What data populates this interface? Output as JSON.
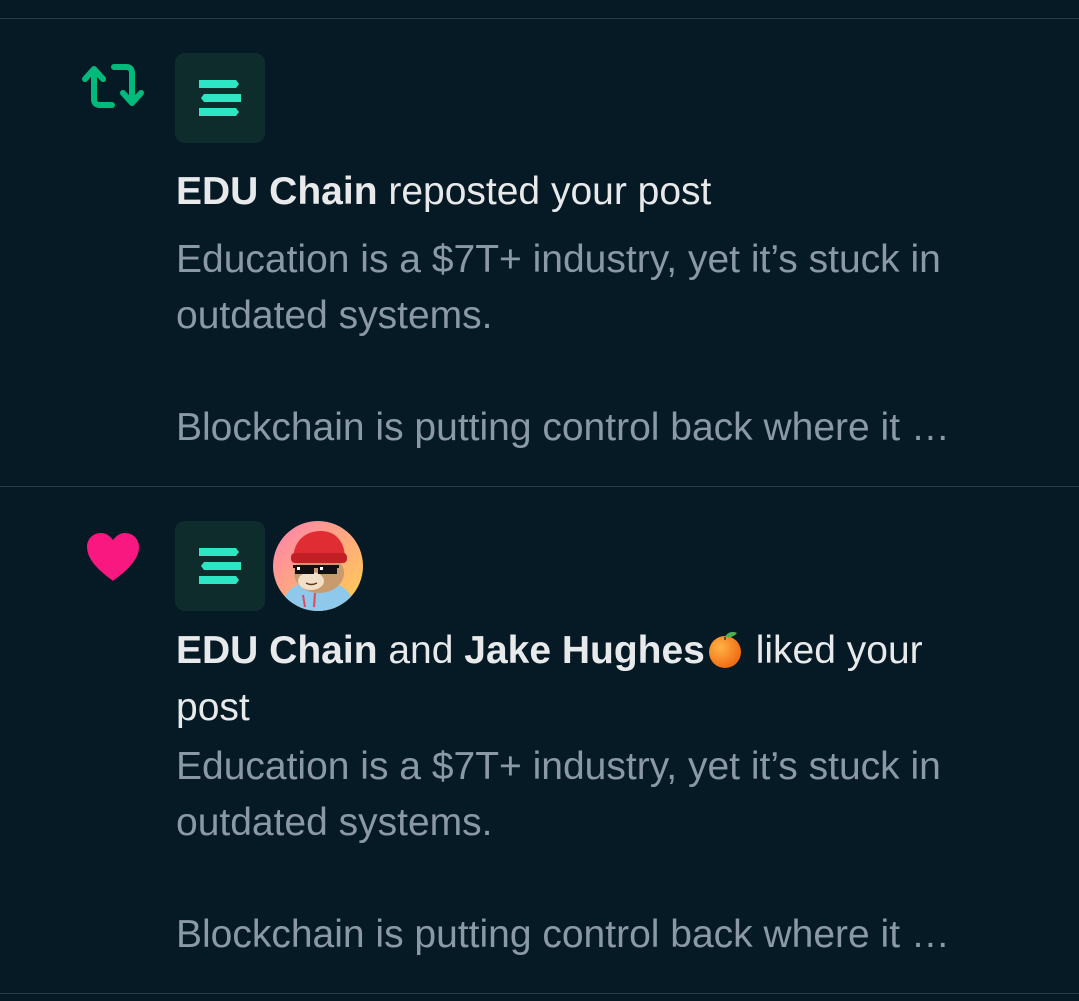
{
  "notifications": [
    {
      "type": "repost",
      "type_icon": "repost-icon",
      "icon_color": "#00ba7c",
      "actors": [
        {
          "name": "EDU Chain",
          "avatar": "edu-chain-logo"
        }
      ],
      "headline": {
        "actor1": "EDU Chain",
        "action": " reposted your post"
      },
      "preview": {
        "line1": "Education is a $7T+ industry, yet it’s stuck in",
        "line2": "outdated systems.",
        "line3": "Blockchain is putting control back where it …"
      }
    },
    {
      "type": "like",
      "type_icon": "heart-icon",
      "icon_color": "#f91880",
      "actors": [
        {
          "name": "EDU Chain",
          "avatar": "edu-chain-logo"
        },
        {
          "name": "Jake Hughes",
          "avatar": "jake-hughes-avatar"
        }
      ],
      "headline": {
        "actor1": "EDU Chain",
        "conjunction": " and ",
        "actor2": "Jake Hughes",
        "emoji": "tangerine-emoji",
        "action": " liked your",
        "action_cont": "post"
      },
      "preview": {
        "line1": "Education is a $7T+ industry, yet it’s stuck in",
        "line2": "outdated systems.",
        "line3": "Blockchain is putting control back where it …"
      }
    }
  ],
  "colors": {
    "background": "#061a26",
    "divider": "#2a3a45",
    "primary_text": "#e7e9ea",
    "secondary_text": "#8b98a5",
    "edu_logo_bg": "#0f2c2c",
    "edu_logo_fg": "#2de6c4"
  }
}
